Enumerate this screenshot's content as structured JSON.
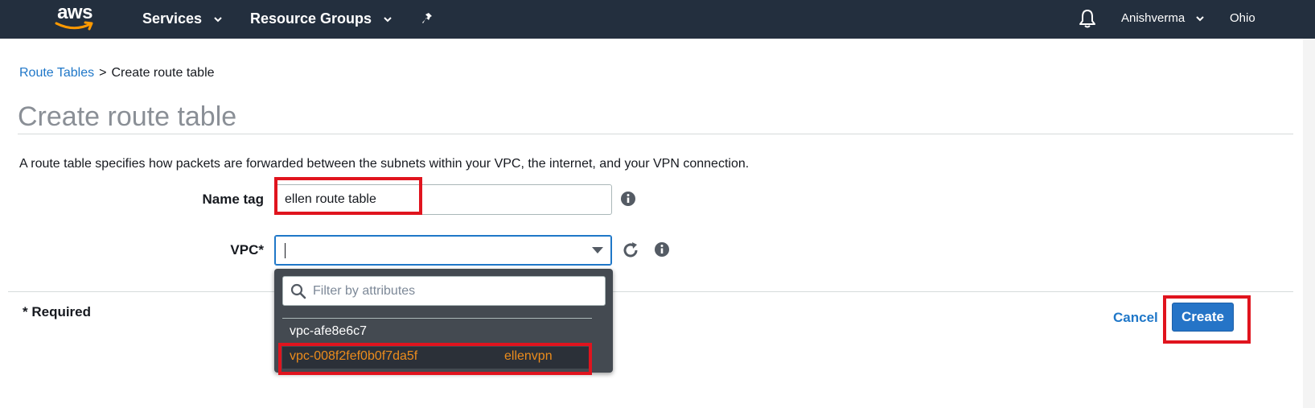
{
  "topnav": {
    "logo_text": "aws",
    "services_label": "Services",
    "resource_groups_label": "Resource Groups",
    "user_label": "Anishverma",
    "region_label": "Ohio"
  },
  "breadcrumb": {
    "parent": "Route Tables",
    "separator": ">",
    "current": "Create route table"
  },
  "page": {
    "title": "Create route table",
    "description": "A route table specifies how packets are forwarded between the subnets within your VPC, the internet, and your VPN connection."
  },
  "form": {
    "name_tag_label": "Name tag",
    "name_tag_value": "ellen route table",
    "vpc_label": "VPC*",
    "vpc_value": ""
  },
  "vpc_dropdown": {
    "filter_placeholder": "Filter by attributes",
    "options": [
      {
        "id": "vpc-afe8e6c7",
        "name": ""
      },
      {
        "id": "vpc-008f2fef0b0f7da5f",
        "name": "ellenvpn"
      }
    ]
  },
  "footer": {
    "required_note": "* Required",
    "cancel_label": "Cancel",
    "create_label": "Create"
  },
  "colors": {
    "nav_bg": "#232f3e",
    "link": "#1f77c8",
    "primary_button": "#2574c7",
    "highlight": "#e0141e",
    "selected_option": "#ec8c1c"
  }
}
